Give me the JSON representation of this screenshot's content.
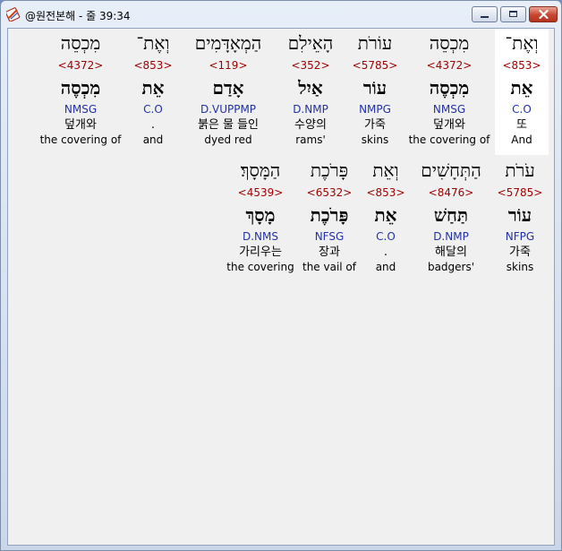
{
  "window": {
    "title": "@원전본해 - 줄 39:34"
  },
  "lines": [
    {
      "words": [
        {
          "hebrew": "וְאֶת־",
          "strongs": "<853>",
          "lemma": "אֵת",
          "parsing": "C.O",
          "korean": "또",
          "english": "And",
          "highlight": true
        },
        {
          "hebrew": "מִכְסֵה",
          "strongs": "<4372>",
          "lemma": "מִכְסֶה",
          "parsing": "NMSG",
          "korean": "덮개와",
          "english": "the covering of",
          "highlight": false
        },
        {
          "hebrew": "עוֹרֹת",
          "strongs": "<5785>",
          "lemma": "עוֹר",
          "parsing": "NMPG",
          "korean": "가죽",
          "english": "skins",
          "highlight": false
        },
        {
          "hebrew": "הָאֵילִם",
          "strongs": "<352>",
          "lemma": "אַיִל",
          "parsing": "D.NMP",
          "korean": "수양의",
          "english": "rams'",
          "highlight": false
        },
        {
          "hebrew": "הַמְאָדָּמִים",
          "strongs": "<119>",
          "lemma": "אָדַם",
          "parsing": "D.VUPPMP",
          "korean": "붉은 물 들인",
          "english": "dyed red",
          "highlight": false
        },
        {
          "hebrew": "וְאֶת־",
          "strongs": "<853>",
          "lemma": "אֵת",
          "parsing": "C.O",
          "korean": ".",
          "english": "and",
          "highlight": false
        },
        {
          "hebrew": "מִכְסֵה",
          "strongs": "<4372>",
          "lemma": "מִכְסֶה",
          "parsing": "NMSG",
          "korean": "덮개와",
          "english": "the covering of",
          "highlight": false
        }
      ]
    },
    {
      "words": [
        {
          "hebrew": "עֹרֹת",
          "strongs": "<5785>",
          "lemma": "עוֹר",
          "parsing": "NFPG",
          "korean": "가죽",
          "english": "skins",
          "highlight": false
        },
        {
          "hebrew": "הַתְּחָשִׁים",
          "strongs": "<8476>",
          "lemma": "תַּחַשׁ",
          "parsing": "D.NMP",
          "korean": "해달의",
          "english": "badgers'",
          "highlight": false
        },
        {
          "hebrew": "וְאֵת",
          "strongs": "<853>",
          "lemma": "אֵת",
          "parsing": "C.O",
          "korean": ".",
          "english": "and",
          "highlight": false
        },
        {
          "hebrew": "פָּרֹכֶת",
          "strongs": "<6532>",
          "lemma": "פָּרֹכֶת",
          "parsing": "NFSG",
          "korean": "장과",
          "english": "the vail of",
          "highlight": false
        },
        {
          "hebrew": "הַמָּסָךְ׃",
          "strongs": "<4539>",
          "lemma": "מָסָךְ",
          "parsing": "D.NMS",
          "korean": "가리우는",
          "english": "the covering",
          "highlight": false
        }
      ]
    }
  ]
}
